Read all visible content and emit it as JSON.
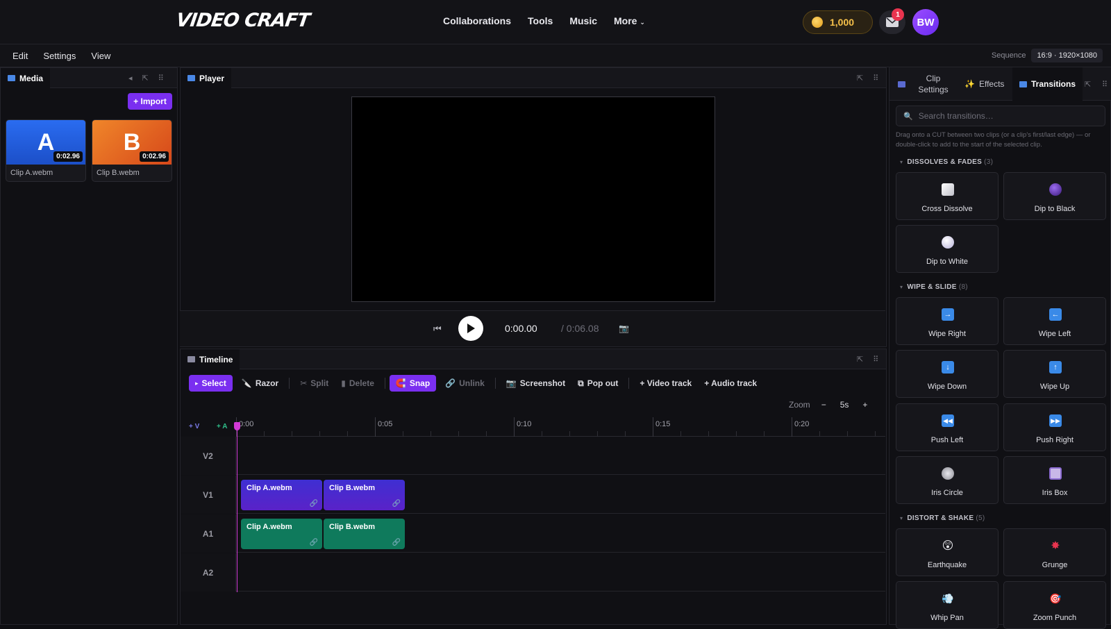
{
  "nav": {
    "logo": "VIDEO CRAFT",
    "links": [
      "Collaborations",
      "Tools",
      "Music",
      "More"
    ],
    "coins": "1,000",
    "mail_badge": "1",
    "avatar": "BW"
  },
  "menu": {
    "items": [
      "Edit",
      "Settings",
      "View"
    ],
    "sequence_label": "Sequence",
    "sequence_value": "16:9 · 1920×1080"
  },
  "media": {
    "tab": "Media",
    "import_label": "+ Import",
    "items": [
      {
        "letter": "A",
        "duration": "0:02.96",
        "name": "Clip A.webm"
      },
      {
        "letter": "B",
        "duration": "0:02.96",
        "name": "Clip B.webm"
      }
    ]
  },
  "player": {
    "tab": "Player",
    "current_time": "0:00.00",
    "total_time": "/ 0:06.08"
  },
  "timeline": {
    "tab": "Timeline",
    "tools": {
      "select": "Select",
      "razor": "Razor",
      "split": "Split",
      "delete": "Delete",
      "snap": "Snap",
      "unlink": "Unlink",
      "screenshot": "Screenshot",
      "popout": "Pop out",
      "video_track": "+ Video track",
      "audio_track": "+ Audio track"
    },
    "zoom_label": "Zoom",
    "zoom_value": "5s",
    "add_v": "+ V",
    "add_a": "+ A",
    "ruler": [
      "0:00",
      "0:05",
      "0:10",
      "0:15",
      "0:20"
    ],
    "tracks": [
      "V2",
      "V1",
      "A1",
      "A2"
    ],
    "clips_v1": [
      "Clip A.webm",
      "Clip B.webm"
    ],
    "clips_a1": [
      "Clip A.webm",
      "Clip B.webm"
    ]
  },
  "right": {
    "tabs": [
      "Clip Settings",
      "Effects",
      "Transitions"
    ],
    "search_placeholder": "Search transitions…",
    "hint": "Drag onto a CUT between two clips (or a clip's first/last edge) — or double-click to add to the start of the selected clip.",
    "sections": [
      {
        "title": "DISSOLVES & FADES",
        "count": "(3)",
        "items": [
          "Cross Dissolve",
          "Dip to Black",
          "Dip to White"
        ]
      },
      {
        "title": "WIPE & SLIDE",
        "count": "(8)",
        "items": [
          "Wipe Right",
          "Wipe Left",
          "Wipe Down",
          "Wipe Up",
          "Push Left",
          "Push Right",
          "Iris Circle",
          "Iris Box"
        ]
      },
      {
        "title": "DISTORT & SHAKE",
        "count": "(5)",
        "items": [
          "Earthquake",
          "Grunge",
          "Whip Pan",
          "Zoom Punch"
        ]
      }
    ]
  },
  "colors": {
    "accent": "#7a2ff0",
    "clip_video": "#4a2bd0",
    "clip_audio": "#0f7a5c",
    "playhead": "#d23ad6"
  }
}
